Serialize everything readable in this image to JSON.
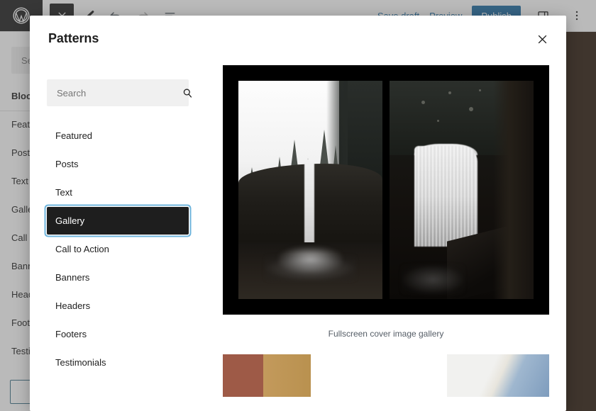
{
  "toolbar": {
    "wp_logo_name": "WordPress",
    "close_label": "×",
    "edit_label": "Edit",
    "undo_label": "Undo",
    "redo_label": "Redo",
    "details_label": "Details",
    "save_draft_label": "Save draft",
    "preview_label": "Preview",
    "publish_label": "Publish",
    "sidebar_toggle_label": "Settings",
    "more_label": "Options",
    "publish_color": "#1d6ca3"
  },
  "background_sidebar": {
    "search_placeholder": "Search",
    "tab_label": "Blocks",
    "items": [
      {
        "label": "Featured"
      },
      {
        "label": "Posts"
      },
      {
        "label": "Text"
      },
      {
        "label": "Gallery"
      },
      {
        "label": "Call to Action"
      },
      {
        "label": "Banners"
      },
      {
        "label": "Headers"
      },
      {
        "label": "Footers"
      },
      {
        "label": "Testimonials"
      }
    ]
  },
  "modal": {
    "title": "Patterns",
    "close_label": "Close",
    "search": {
      "placeholder": "Search",
      "value": ""
    },
    "categories": [
      {
        "label": "Featured",
        "selected": false
      },
      {
        "label": "Posts",
        "selected": false
      },
      {
        "label": "Text",
        "selected": false
      },
      {
        "label": "Gallery",
        "selected": true
      },
      {
        "label": "Call to Action",
        "selected": false
      },
      {
        "label": "Banners",
        "selected": false
      },
      {
        "label": "Headers",
        "selected": false
      },
      {
        "label": "Footers",
        "selected": false
      },
      {
        "label": "Testimonials",
        "selected": false
      }
    ],
    "selected_category": "Gallery",
    "selection_ring_color": "#6fb5dd",
    "selection_fill_color": "#1e1e1e",
    "patterns": [
      {
        "caption": "Fullscreen cover image gallery",
        "preview_bg": "#000000",
        "photos": [
          {
            "alt": "Black and white photo of a tall waterfall below a forest ridge"
          },
          {
            "alt": "Black and white photo of a wide waterfall framed by dark foliage"
          }
        ]
      }
    ],
    "partial_patterns": [
      {
        "alt": "Warm brown and tan two-tone pattern thumbnail"
      },
      {
        "alt": "Pale sky and blue diagonal pattern thumbnail"
      }
    ]
  }
}
